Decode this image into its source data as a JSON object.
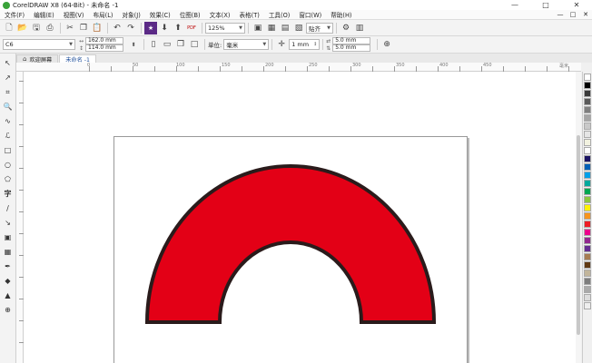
{
  "window": {
    "title": "CorelDRAW X8 (64-Bit) - 未命名 -1",
    "controls": [
      "—",
      "□",
      "✕"
    ]
  },
  "menu": {
    "items": [
      {
        "label": "文件(F)"
      },
      {
        "label": "编辑(E)"
      },
      {
        "label": "视图(V)"
      },
      {
        "label": "布局(L)"
      },
      {
        "label": "对象(J)"
      },
      {
        "label": "效果(C)"
      },
      {
        "label": "位图(B)"
      },
      {
        "label": "文本(X)"
      },
      {
        "label": "表格(T)"
      },
      {
        "label": "工具(O)"
      },
      {
        "label": "窗口(W)"
      },
      {
        "label": "帮助(H)"
      }
    ],
    "right_controls": [
      "—",
      "□",
      "✕"
    ]
  },
  "toolbar": {
    "zoom_value": "125%",
    "snap_label": "贴齐",
    "pdf_label": "PDF"
  },
  "propertybar": {
    "page_size": "C6",
    "width": "162.0 mm",
    "height": "114.0 mm",
    "units_label": "单位:",
    "units_value": "毫米",
    "nudge": "1 mm",
    "dup_x": "5.0 mm",
    "dup_y": "5.0 mm"
  },
  "tabs": [
    {
      "label": "欢迎屏幕",
      "active": false
    },
    {
      "label": "未命名 -1",
      "active": true
    }
  ],
  "ruler": {
    "h_labels": [
      {
        "text": "0"
      },
      {
        "text": "50"
      },
      {
        "text": "100"
      },
      {
        "text": "150"
      },
      {
        "text": "200"
      },
      {
        "text": "250"
      },
      {
        "text": "300"
      },
      {
        "text": "350"
      },
      {
        "text": "400"
      },
      {
        "text": "450"
      },
      {
        "text": "毫米"
      }
    ]
  },
  "shape": {
    "fill": "#e30016",
    "stroke": "#2a1b1b"
  },
  "palette": [
    "#ffffff",
    "#000000",
    "#3a3a3a",
    "#595959",
    "#7f7f7f",
    "#a5a5a5",
    "#c9c9c9",
    "#e5e5e5",
    "#f2f2e0",
    "#ffffff",
    "#1b1464",
    "#0060b6",
    "#00a0e9",
    "#00a99d",
    "#00a651",
    "#8dc63f",
    "#fff200",
    "#f7941d",
    "#ed1c24",
    "#ec008c",
    "#92278f",
    "#662d91",
    "#a67c52",
    "#603913",
    "#c2b59b",
    "#7d7d7d",
    "#aaaaaa",
    "#dddddd",
    "#eeeeee"
  ]
}
